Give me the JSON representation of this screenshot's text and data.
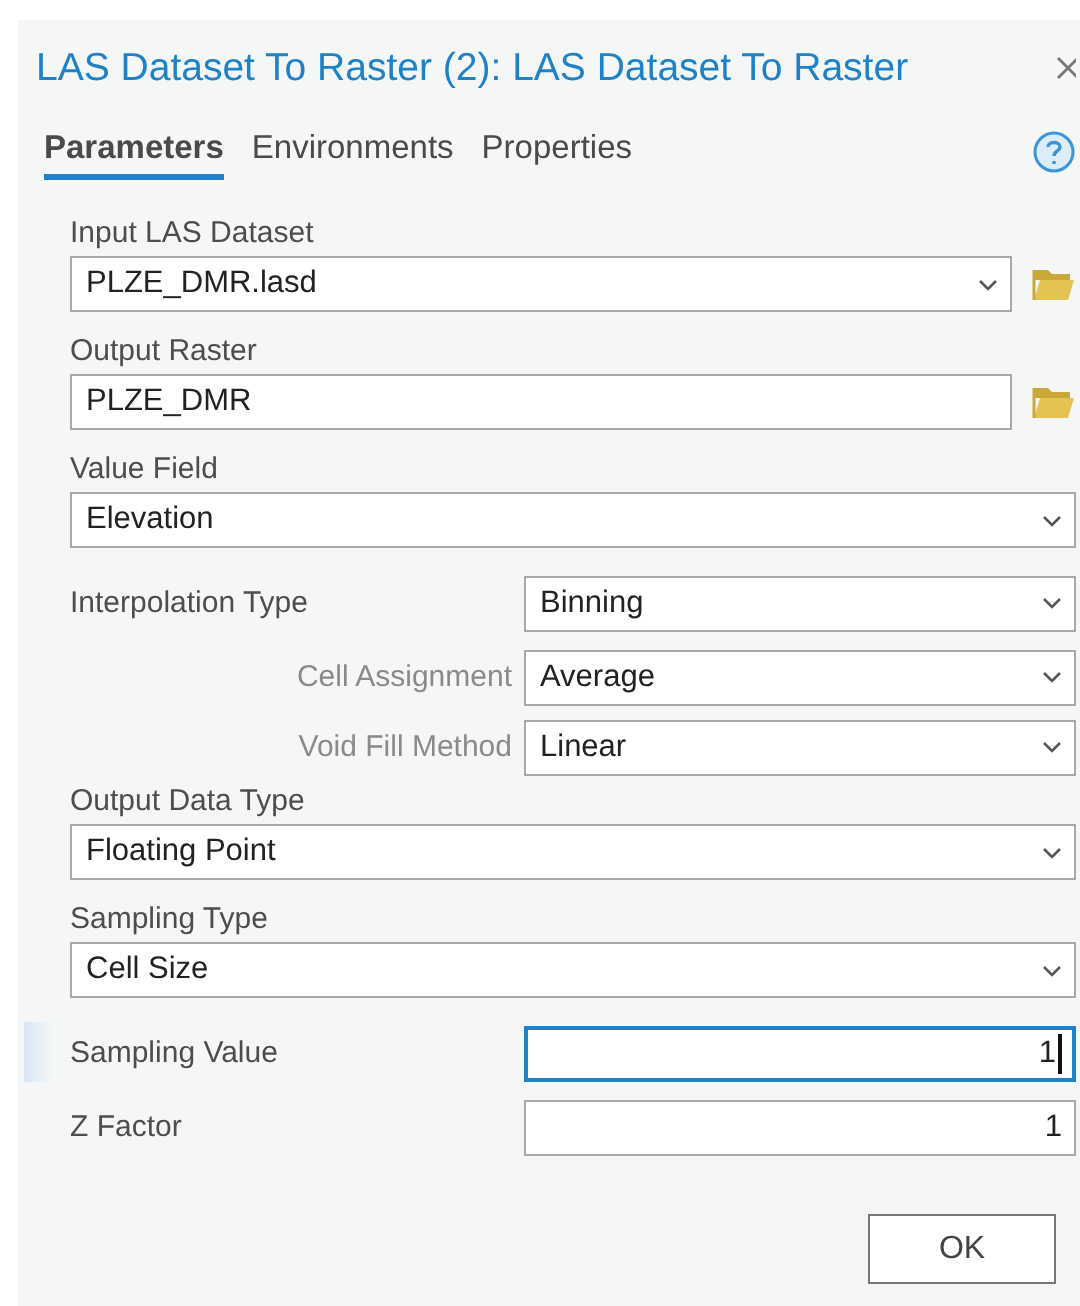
{
  "window": {
    "title": "LAS Dataset To Raster (2): LAS Dataset To Raster"
  },
  "tabs": [
    {
      "label": "Parameters",
      "selected": true
    },
    {
      "label": "Environments",
      "selected": false
    },
    {
      "label": "Properties",
      "selected": false
    }
  ],
  "parameters": [
    {
      "kind": "dropdown",
      "inline": false,
      "label": "Input LAS Dataset",
      "value": "PLZE_DMR.lasd",
      "browse": true
    },
    {
      "kind": "text",
      "inline": false,
      "label": "Output Raster",
      "value": "PLZE_DMR",
      "browse": true
    },
    {
      "kind": "dropdown",
      "inline": false,
      "label": "Value Field",
      "value": "Elevation",
      "browse": false
    },
    {
      "kind": "dropdown",
      "inline": true,
      "label": "Interpolation Type",
      "value": "Binning",
      "children": [
        {
          "kind": "dropdown",
          "label": "Cell Assignment",
          "value": "Average"
        },
        {
          "kind": "dropdown",
          "label": "Void Fill Method",
          "value": "Linear"
        }
      ]
    },
    {
      "kind": "dropdown",
      "inline": false,
      "label": "Output Data Type",
      "value": "Floating Point",
      "browse": false
    },
    {
      "kind": "dropdown",
      "inline": false,
      "label": "Sampling Type",
      "value": "Cell Size",
      "browse": false
    },
    {
      "kind": "number",
      "inline": true,
      "label": "Sampling Value",
      "value": "1",
      "focused": true
    },
    {
      "kind": "number",
      "inline": true,
      "label": "Z Factor",
      "value": "1",
      "focused": false
    }
  ],
  "buttons": [
    {
      "label": "OK"
    }
  ]
}
